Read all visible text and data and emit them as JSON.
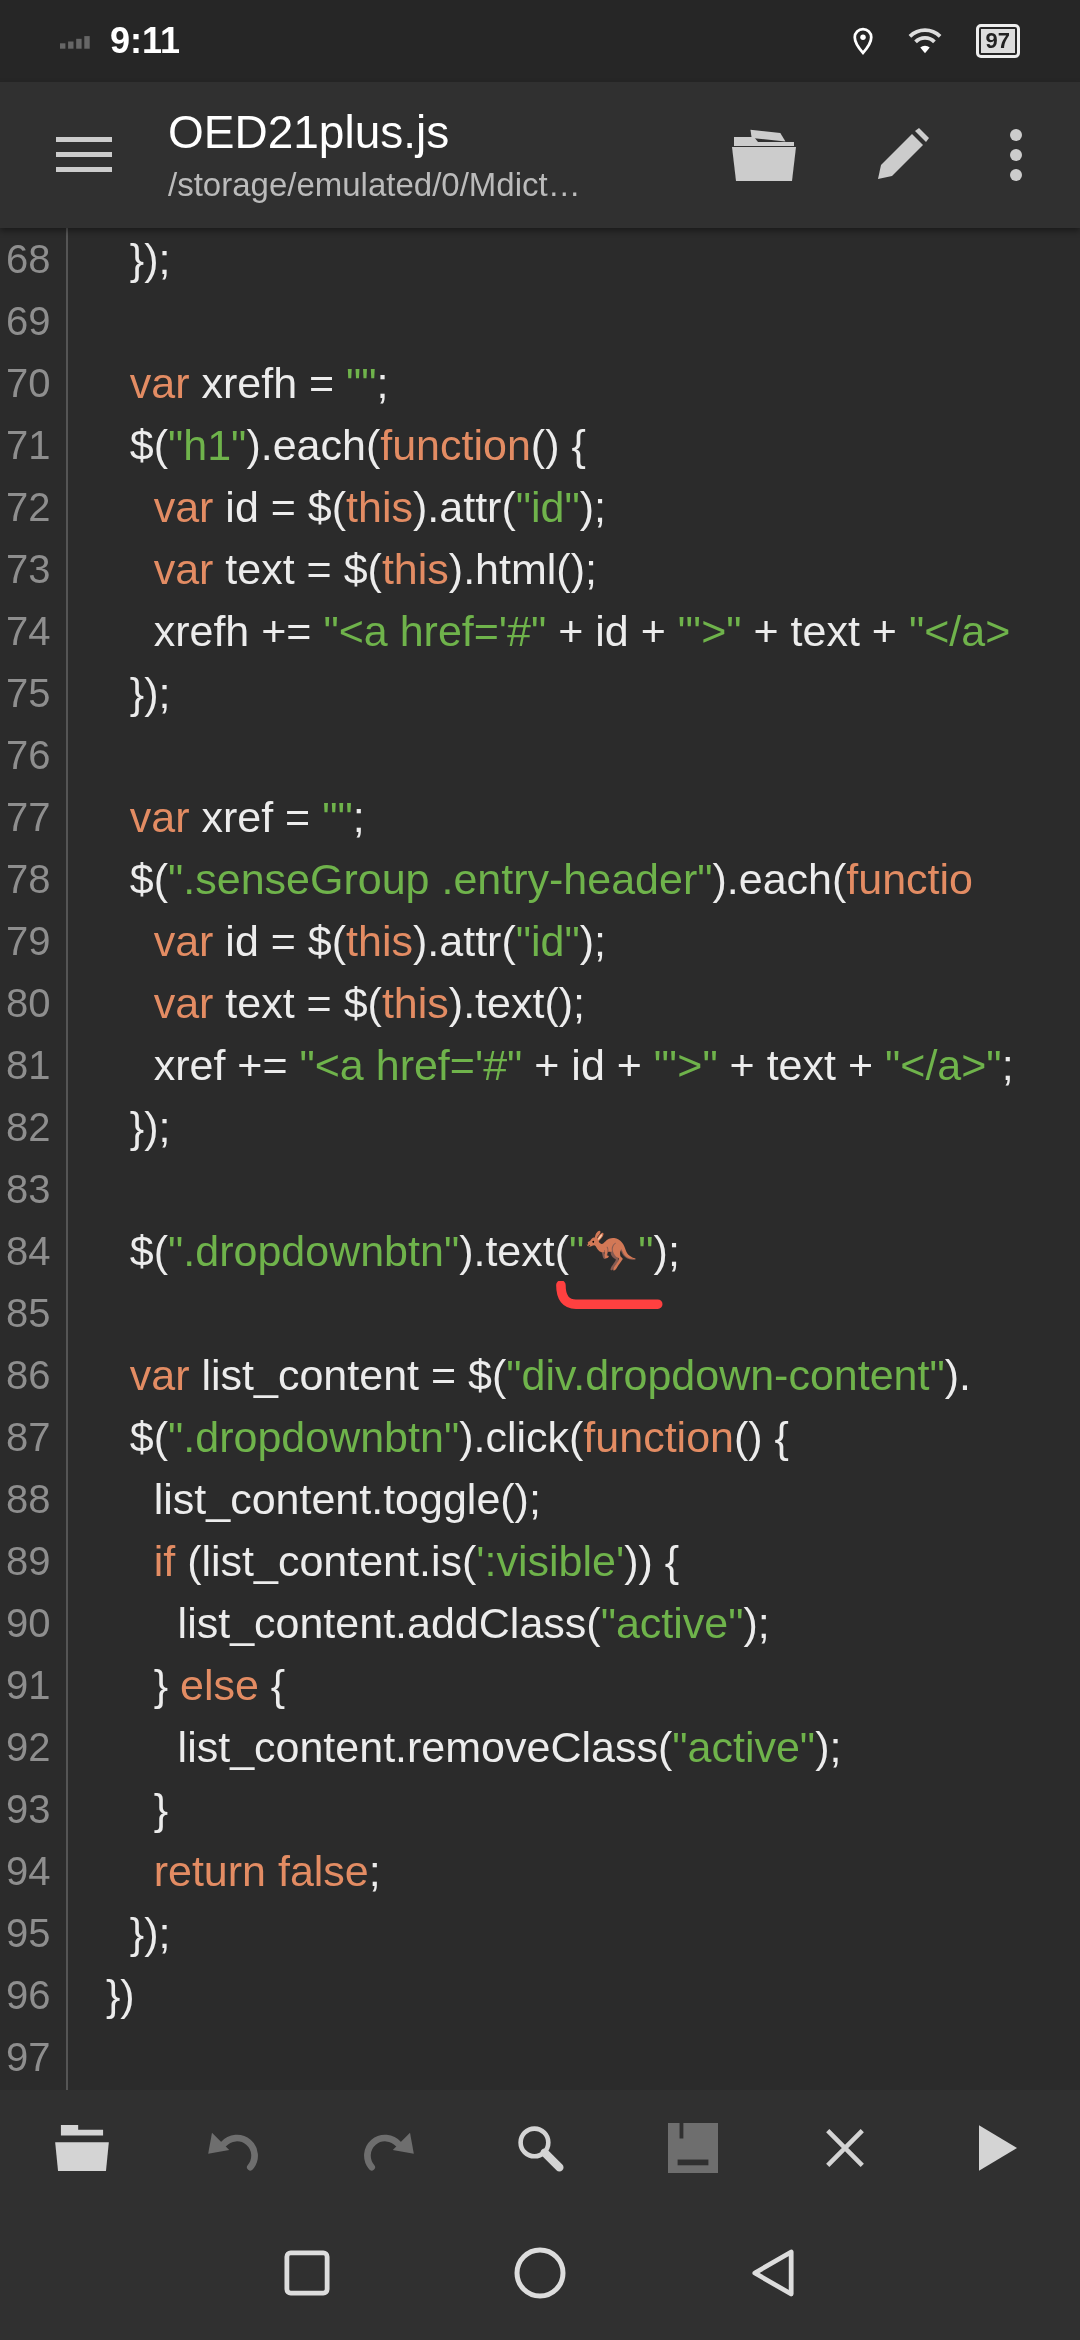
{
  "status_bar": {
    "time": "9:11",
    "battery": "97"
  },
  "app_bar": {
    "title": "OED21plus.js",
    "subtitle": "/storage/emulated/0/Mdict…",
    "actions": [
      {
        "kind": "folder"
      },
      {
        "kind": "edit"
      },
      {
        "kind": "more"
      }
    ]
  },
  "editor": {
    "lines": [
      {
        "number": "68",
        "tokens": [
          {
            "kind": "plain",
            "text": "    });"
          }
        ]
      },
      {
        "number": "69"
      },
      {
        "number": "70",
        "tokens": [
          {
            "kind": "keyword",
            "text": "    var"
          },
          {
            "kind": "plain",
            "text": " xrefh = "
          },
          {
            "kind": "string",
            "text": "\"\""
          },
          {
            "kind": "plain",
            "text": ";"
          }
        ]
      },
      {
        "number": "71",
        "tokens": [
          {
            "kind": "plain",
            "text": "    $("
          },
          {
            "kind": "string",
            "text": "\"h1\""
          },
          {
            "kind": "plain",
            "text": ").each("
          },
          {
            "kind": "keyword",
            "text": "function"
          },
          {
            "kind": "plain",
            "text": "() {"
          }
        ]
      },
      {
        "number": "72",
        "tokens": [
          {
            "kind": "keyword",
            "text": "      var"
          },
          {
            "kind": "plain",
            "text": " id = $("
          },
          {
            "kind": "keyword",
            "text": "this"
          },
          {
            "kind": "plain",
            "text": ").attr("
          },
          {
            "kind": "string",
            "text": "\"id\""
          },
          {
            "kind": "plain",
            "text": ");"
          }
        ]
      },
      {
        "number": "73",
        "tokens": [
          {
            "kind": "keyword",
            "text": "      var"
          },
          {
            "kind": "plain",
            "text": " text = $("
          },
          {
            "kind": "keyword",
            "text": "this"
          },
          {
            "kind": "plain",
            "text": ").html();"
          }
        ]
      },
      {
        "number": "74",
        "tokens": [
          {
            "kind": "plain",
            "text": "      xrefh += "
          },
          {
            "kind": "string",
            "text": "\"<a href='#\""
          },
          {
            "kind": "plain",
            "text": " + id + "
          },
          {
            "kind": "string",
            "text": "\"'>\""
          },
          {
            "kind": "plain",
            "text": " + text + "
          },
          {
            "kind": "string",
            "text": "\"</a>"
          }
        ]
      },
      {
        "number": "75",
        "tokens": [
          {
            "kind": "plain",
            "text": "    });"
          }
        ]
      },
      {
        "number": "76"
      },
      {
        "number": "77",
        "tokens": [
          {
            "kind": "keyword",
            "text": "    var"
          },
          {
            "kind": "plain",
            "text": " xref = "
          },
          {
            "kind": "string",
            "text": "\"\""
          },
          {
            "kind": "plain",
            "text": ";"
          }
        ]
      },
      {
        "number": "78",
        "tokens": [
          {
            "kind": "plain",
            "text": "    $("
          },
          {
            "kind": "string",
            "text": "\".senseGroup .entry-header\""
          },
          {
            "kind": "plain",
            "text": ").each("
          },
          {
            "kind": "keyword",
            "text": "functio"
          }
        ]
      },
      {
        "number": "79",
        "tokens": [
          {
            "kind": "keyword",
            "text": "      var"
          },
          {
            "kind": "plain",
            "text": " id = $("
          },
          {
            "kind": "keyword",
            "text": "this"
          },
          {
            "kind": "plain",
            "text": ").attr("
          },
          {
            "kind": "string",
            "text": "\"id\""
          },
          {
            "kind": "plain",
            "text": ");"
          }
        ]
      },
      {
        "number": "80",
        "tokens": [
          {
            "kind": "keyword",
            "text": "      var"
          },
          {
            "kind": "plain",
            "text": " text = $("
          },
          {
            "kind": "keyword",
            "text": "this"
          },
          {
            "kind": "plain",
            "text": ").text();"
          }
        ]
      },
      {
        "number": "81",
        "tokens": [
          {
            "kind": "plain",
            "text": "      xref += "
          },
          {
            "kind": "string",
            "text": "\"<a href='#\""
          },
          {
            "kind": "plain",
            "text": " + id + "
          },
          {
            "kind": "string",
            "text": "\"'>\""
          },
          {
            "kind": "plain",
            "text": " + text + "
          },
          {
            "kind": "string",
            "text": "\"</a>\""
          },
          {
            "kind": "plain",
            "text": ";"
          }
        ]
      },
      {
        "number": "82",
        "tokens": [
          {
            "kind": "plain",
            "text": "    });"
          }
        ]
      },
      {
        "number": "83"
      },
      {
        "number": "84",
        "tokens": [
          {
            "kind": "plain",
            "text": "    $("
          },
          {
            "kind": "string",
            "text": "\".dropdownbtn\""
          },
          {
            "kind": "plain",
            "text": ").text("
          },
          {
            "kind": "string",
            "text": "\"🦘\"",
            "underlined": true
          },
          {
            "kind": "plain",
            "text": ");"
          }
        ]
      },
      {
        "number": "85"
      },
      {
        "number": "86",
        "tokens": [
          {
            "kind": "keyword",
            "text": "    var"
          },
          {
            "kind": "plain",
            "text": " list_content = $("
          },
          {
            "kind": "string",
            "text": "\"div.dropdown-content\""
          },
          {
            "kind": "plain",
            "text": ")."
          }
        ]
      },
      {
        "number": "87",
        "tokens": [
          {
            "kind": "plain",
            "text": "    $("
          },
          {
            "kind": "string",
            "text": "\".dropdownbtn\""
          },
          {
            "kind": "plain",
            "text": ").click("
          },
          {
            "kind": "keyword",
            "text": "function"
          },
          {
            "kind": "plain",
            "text": "() {"
          }
        ]
      },
      {
        "number": "88",
        "tokens": [
          {
            "kind": "plain",
            "text": "      list_content.toggle();"
          }
        ]
      },
      {
        "number": "89",
        "tokens": [
          {
            "kind": "keyword",
            "text": "      if"
          },
          {
            "kind": "plain",
            "text": " (list_content.is("
          },
          {
            "kind": "string",
            "text": "':visible'"
          },
          {
            "kind": "plain",
            "text": ")) {"
          }
        ]
      },
      {
        "number": "90",
        "tokens": [
          {
            "kind": "plain",
            "text": "        list_content.addClass("
          },
          {
            "kind": "string",
            "text": "\"active\""
          },
          {
            "kind": "plain",
            "text": ");"
          }
        ]
      },
      {
        "number": "91",
        "tokens": [
          {
            "kind": "plain",
            "text": "      } "
          },
          {
            "kind": "keyword",
            "text": "else"
          },
          {
            "kind": "plain",
            "text": " {"
          }
        ]
      },
      {
        "number": "92",
        "tokens": [
          {
            "kind": "plain",
            "text": "        list_content.removeClass("
          },
          {
            "kind": "string",
            "text": "\"active\""
          },
          {
            "kind": "plain",
            "text": ");"
          }
        ]
      },
      {
        "number": "93",
        "tokens": [
          {
            "kind": "plain",
            "text": "      }"
          }
        ]
      },
      {
        "number": "94",
        "tokens": [
          {
            "kind": "keyword",
            "text": "      return false"
          },
          {
            "kind": "plain",
            "text": ";"
          }
        ]
      },
      {
        "number": "95",
        "tokens": [
          {
            "kind": "plain",
            "text": "    });"
          }
        ]
      },
      {
        "number": "96",
        "tokens": [
          {
            "kind": "plain",
            "text": "  })"
          }
        ]
      },
      {
        "number": "97"
      }
    ]
  },
  "toolbar": [
    {
      "kind": "open",
      "disabled": false
    },
    {
      "kind": "undo",
      "disabled": true
    },
    {
      "kind": "redo",
      "disabled": true
    },
    {
      "kind": "search",
      "disabled": false
    },
    {
      "kind": "save",
      "disabled": true
    },
    {
      "kind": "close",
      "disabled": false
    },
    {
      "kind": "run",
      "disabled": false
    }
  ],
  "nav_bar": [
    {
      "kind": "recents"
    },
    {
      "kind": "home"
    },
    {
      "kind": "back"
    }
  ]
}
